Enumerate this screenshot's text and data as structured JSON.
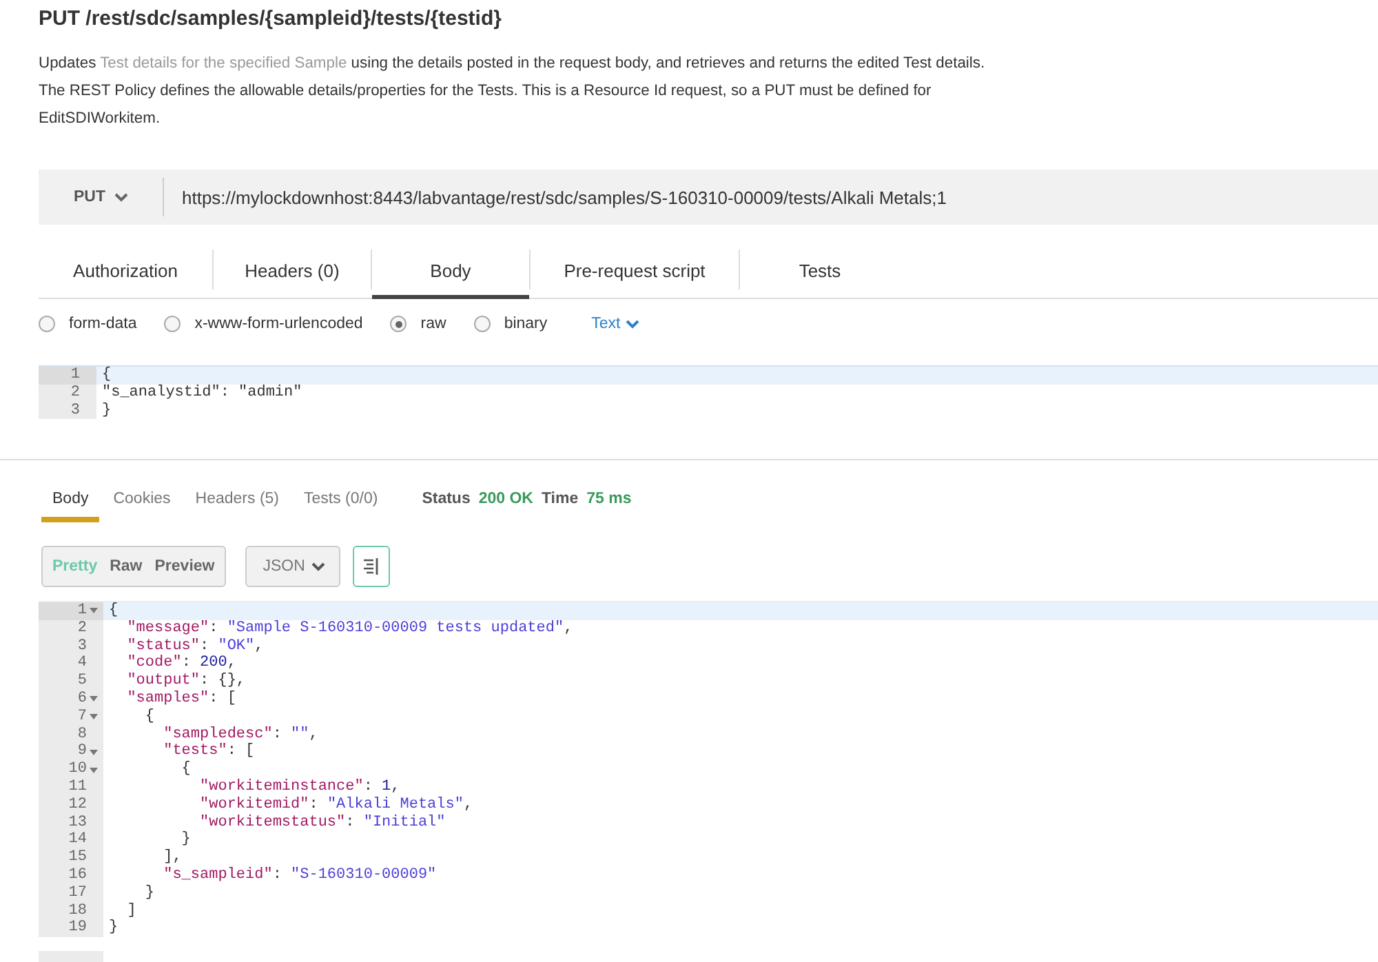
{
  "title": "PUT /rest/sdc/samples/{sampleid}/tests/{testid}",
  "description": [
    [
      {
        "kind": "plain",
        "text": "Updates "
      },
      {
        "kind": "link",
        "text": "Test details for the specified Sample"
      },
      {
        "kind": "plain",
        "text": " using the details posted in the request body, and retrieves and returns the edited Test details."
      }
    ],
    [
      {
        "kind": "plain",
        "text": "The REST Policy defines the allowable details/properties for the Tests. This is a Resource Id request, so a PUT must be defined for"
      }
    ],
    [
      {
        "kind": "plain",
        "text": "EditSDIWorkitem."
      }
    ]
  ],
  "request": {
    "method": "PUT",
    "url": "https://mylockdownhost:8443/labvantage/rest/sdc/samples/S-160310-00009/tests/Alkali Metals;1",
    "tabs": [
      {
        "label": "Authorization",
        "selected": false
      },
      {
        "label": "Headers (0)",
        "selected": false
      },
      {
        "label": "Body",
        "selected": true
      },
      {
        "label": "Pre-request script",
        "selected": false
      },
      {
        "label": "Tests",
        "selected": false
      }
    ],
    "body_modes": [
      {
        "label": "form-data",
        "selected": false
      },
      {
        "label": "x-www-form-urlencoded",
        "selected": false
      },
      {
        "label": "raw",
        "selected": true
      },
      {
        "label": "binary",
        "selected": false
      }
    ],
    "format": "Text",
    "lines": [
      {
        "number": "1",
        "active": true,
        "foldable": false,
        "tokens": [
          {
            "text": "{"
          }
        ]
      },
      {
        "number": "2",
        "active": false,
        "foldable": false,
        "tokens": [
          {
            "text": "\"s_analystid\": \"admin\""
          }
        ]
      },
      {
        "number": "3",
        "active": false,
        "foldable": false,
        "tokens": [
          {
            "text": "}"
          }
        ]
      }
    ]
  },
  "response": {
    "tabs": [
      {
        "label": "Body",
        "selected": true
      },
      {
        "label": "Cookies",
        "selected": false
      },
      {
        "label": "Headers (5)",
        "selected": false
      },
      {
        "label": "Tests (0/0)",
        "selected": false
      }
    ],
    "status_label": "Status",
    "status": "200 OK",
    "time_label": "Time",
    "time": "75 ms",
    "views": [
      {
        "label": "Pretty",
        "selected": true
      },
      {
        "label": "Raw",
        "selected": false
      },
      {
        "label": "Preview",
        "selected": false
      }
    ],
    "format": "JSON",
    "lines": [
      {
        "number": "1",
        "active": true,
        "foldable": true,
        "tokens": [
          {
            "kind": "punct",
            "text": "{"
          }
        ]
      },
      {
        "number": "2",
        "active": false,
        "foldable": false,
        "tokens": [
          {
            "kind": "key",
            "text": "  \"message\""
          },
          {
            "kind": "punct",
            "text": ": "
          },
          {
            "kind": "string",
            "text": "\"Sample S-160310-00009 tests updated\""
          },
          {
            "kind": "punct",
            "text": ","
          }
        ]
      },
      {
        "number": "3",
        "active": false,
        "foldable": false,
        "tokens": [
          {
            "kind": "key",
            "text": "  \"status\""
          },
          {
            "kind": "punct",
            "text": ": "
          },
          {
            "kind": "string",
            "text": "\"OK\""
          },
          {
            "kind": "punct",
            "text": ","
          }
        ]
      },
      {
        "number": "4",
        "active": false,
        "foldable": false,
        "tokens": [
          {
            "kind": "key",
            "text": "  \"code\""
          },
          {
            "kind": "punct",
            "text": ": "
          },
          {
            "kind": "number",
            "text": "200"
          },
          {
            "kind": "punct",
            "text": ","
          }
        ]
      },
      {
        "number": "5",
        "active": false,
        "foldable": false,
        "tokens": [
          {
            "kind": "key",
            "text": "  \"output\""
          },
          {
            "kind": "punct",
            "text": ": {},"
          }
        ]
      },
      {
        "number": "6",
        "active": false,
        "foldable": true,
        "tokens": [
          {
            "kind": "key",
            "text": "  \"samples\""
          },
          {
            "kind": "punct",
            "text": ": ["
          }
        ]
      },
      {
        "number": "7",
        "active": false,
        "foldable": true,
        "tokens": [
          {
            "kind": "punct",
            "text": "    {"
          }
        ]
      },
      {
        "number": "8",
        "active": false,
        "foldable": false,
        "tokens": [
          {
            "kind": "key",
            "text": "      \"sampledesc\""
          },
          {
            "kind": "punct",
            "text": ": "
          },
          {
            "kind": "string",
            "text": "\"\""
          },
          {
            "kind": "punct",
            "text": ","
          }
        ]
      },
      {
        "number": "9",
        "active": false,
        "foldable": true,
        "tokens": [
          {
            "kind": "key",
            "text": "      \"tests\""
          },
          {
            "kind": "punct",
            "text": ": ["
          }
        ]
      },
      {
        "number": "10",
        "active": false,
        "foldable": true,
        "tokens": [
          {
            "kind": "punct",
            "text": "        {"
          }
        ]
      },
      {
        "number": "11",
        "active": false,
        "foldable": false,
        "tokens": [
          {
            "kind": "key",
            "text": "          \"workiteminstance\""
          },
          {
            "kind": "punct",
            "text": ": "
          },
          {
            "kind": "number",
            "text": "1"
          },
          {
            "kind": "punct",
            "text": ","
          }
        ]
      },
      {
        "number": "12",
        "active": false,
        "foldable": false,
        "tokens": [
          {
            "kind": "key",
            "text": "          \"workitemid\""
          },
          {
            "kind": "punct",
            "text": ": "
          },
          {
            "kind": "string",
            "text": "\"Alkali Metals\""
          },
          {
            "kind": "punct",
            "text": ","
          }
        ]
      },
      {
        "number": "13",
        "active": false,
        "foldable": false,
        "tokens": [
          {
            "kind": "key",
            "text": "          \"workitemstatus\""
          },
          {
            "kind": "punct",
            "text": ": "
          },
          {
            "kind": "string",
            "text": "\"Initial\""
          }
        ]
      },
      {
        "number": "14",
        "active": false,
        "foldable": false,
        "tokens": [
          {
            "kind": "punct",
            "text": "        }"
          }
        ]
      },
      {
        "number": "15",
        "active": false,
        "foldable": false,
        "tokens": [
          {
            "kind": "punct",
            "text": "      ],"
          }
        ]
      },
      {
        "number": "16",
        "active": false,
        "foldable": false,
        "tokens": [
          {
            "kind": "key",
            "text": "      \"s_sampleid\""
          },
          {
            "kind": "punct",
            "text": ": "
          },
          {
            "kind": "string",
            "text": "\"S-160310-00009\""
          }
        ]
      },
      {
        "number": "17",
        "active": false,
        "foldable": false,
        "tokens": [
          {
            "kind": "punct",
            "text": "    }"
          }
        ]
      },
      {
        "number": "18",
        "active": false,
        "foldable": false,
        "tokens": [
          {
            "kind": "punct",
            "text": "  ]"
          }
        ]
      },
      {
        "number": "19",
        "active": false,
        "foldable": false,
        "tokens": [
          {
            "kind": "punct",
            "text": "}"
          }
        ]
      }
    ]
  }
}
